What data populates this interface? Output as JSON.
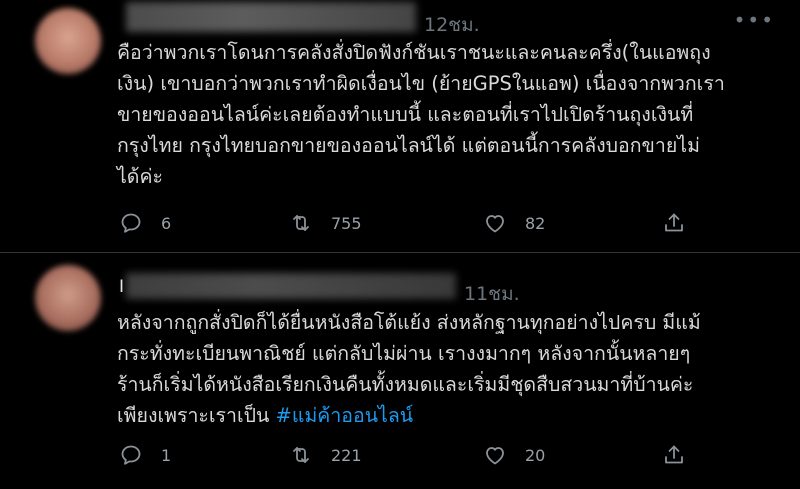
{
  "tweets": [
    {
      "time": "12ชม.",
      "more": "•••",
      "lines": [
        "คือว่าพวกเราโดนการคลังสั่งปิดฟังก์ชันเราชนะและคนละครึ่ง(ในแอพถุง",
        "เงิน) เขาบอกว่าพวกเราทำผิดเงื่อนไข (ย้ายGPSในแอพ) เนื่องจากพวกเรา",
        "ขายของออนไลน์ค่ะเลยต้องทำแบบนี้ และตอนที่เราไปเปิดร้านถุงเงินที่",
        "กรุงไทย กรุงไทยบอกขายของออนไลน์ได้ แต่ตอนนี้การคลังบอกขายไม่",
        "ได้ค่ะ"
      ],
      "stats": {
        "replies": "6",
        "retweets": "755",
        "likes": "82"
      }
    },
    {
      "name_visible": "I",
      "time": "11ชม.",
      "lines": [
        "หลังจากถูกสั่งปิดก็ได้ยื่นหนังสือโต้แย้ง ส่งหลักฐานทุกอย่างไปครบ มีแม้",
        "กระทั่งทะเบียนพาณิชย์ แต่กลับไม่ผ่าน เรางงมากๆ หลังจากนั้นหลายๆ",
        "ร้านก็เริ่มได้หนังสือเรียกเงินคืนทั้งหมดและเริ่มมีชุดสืบสวนมาที่บ้านค่ะ"
      ],
      "last_line_text": "เพียงเพราะเราเป็น ",
      "hashtag": "#แม่ค้าออนไลน์",
      "stats": {
        "replies": "1",
        "retweets": "221",
        "likes": "20"
      }
    }
  ],
  "colors": {
    "background": "#000000",
    "text": "#d9d9d9",
    "muted": "#6e767d",
    "hashtag": "#1d9bf0"
  },
  "icons": [
    "reply-icon",
    "retweet-icon",
    "like-icon",
    "share-icon"
  ]
}
